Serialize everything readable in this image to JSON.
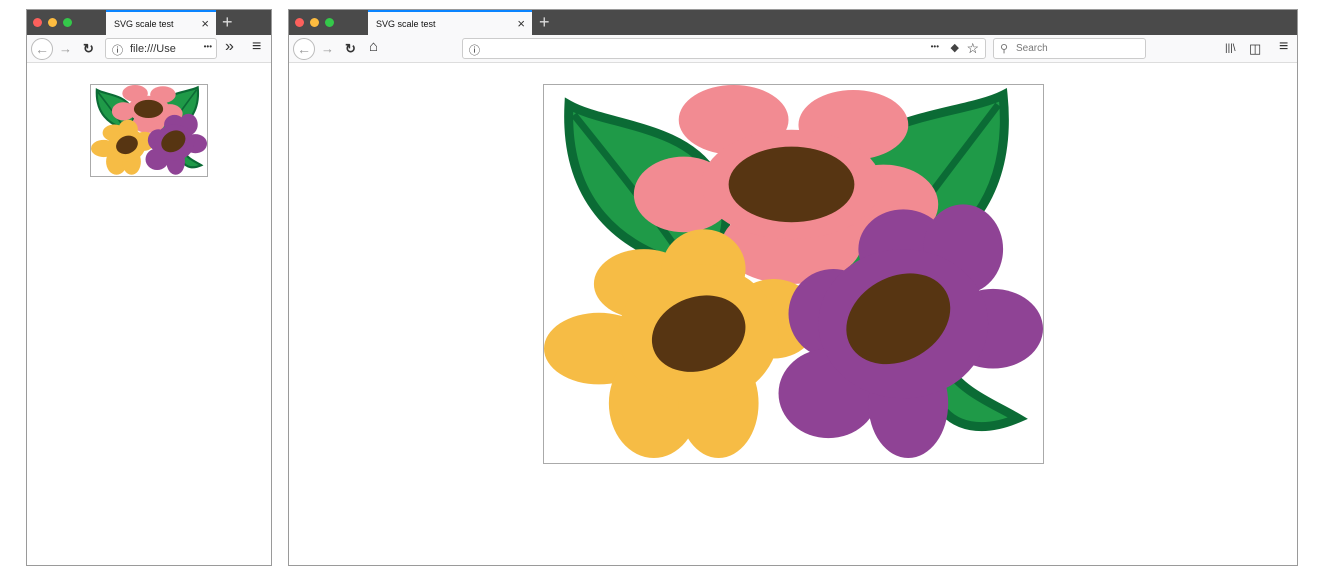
{
  "small_window": {
    "tab_title": "SVG scale test",
    "url": "file:///Use"
  },
  "large_window": {
    "tab_title": "SVG scale test",
    "url": "",
    "search_placeholder": "Search"
  },
  "icons": {
    "close": "×",
    "new_tab": "+",
    "back": "←",
    "forward": "→",
    "reload": "↻",
    "home": "⌂",
    "info": "ⓘ",
    "more": "•••",
    "overflow": "»",
    "menu": "≡",
    "star": "☆",
    "search": "⚲",
    "library": "|||\\",
    "sidebar": "◫",
    "pocket": "◆"
  },
  "colors": {
    "tabbar": "#4a4a4a",
    "accent": "#0a84ff",
    "leaf": "#1f9a48",
    "leaf_outline": "#0b6b35",
    "pink": "#f28b92",
    "yellow": "#f6bc45",
    "purple": "#8f4395",
    "center": "#573512"
  }
}
